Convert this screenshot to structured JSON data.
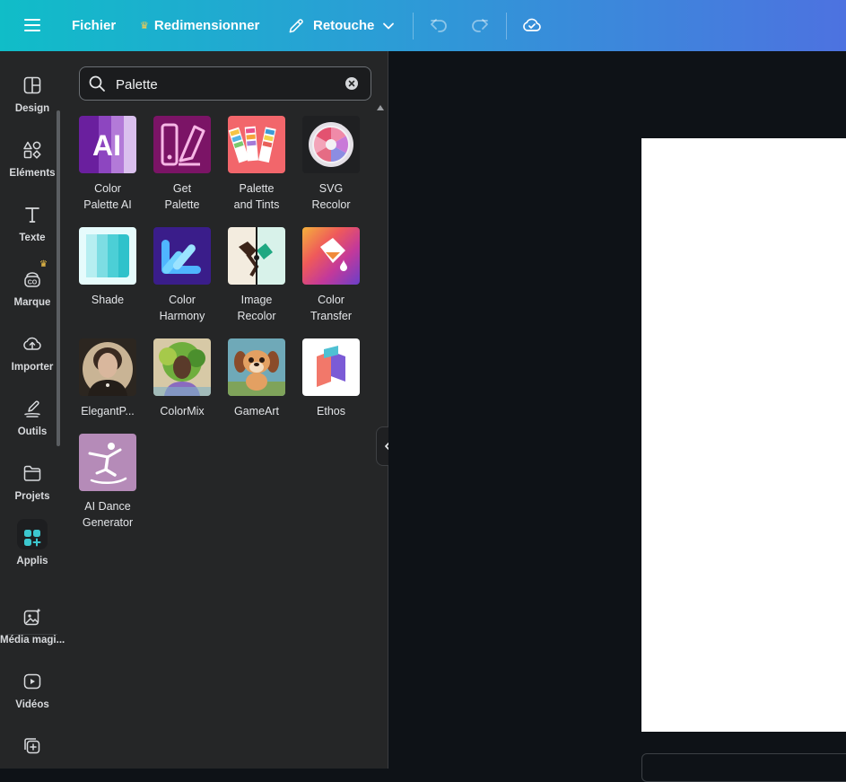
{
  "topbar": {
    "fichier": "Fichier",
    "resize": "Redimensionner",
    "retouche": "Retouche"
  },
  "rail": {
    "items": [
      {
        "label": "Design",
        "icon": "layout-icon"
      },
      {
        "label": "Éléments",
        "icon": "shapes-icon"
      },
      {
        "label": "Texte",
        "icon": "text-icon"
      },
      {
        "label": "Marque",
        "icon": "brand-icon"
      },
      {
        "label": "Importer",
        "icon": "cloud-upload-icon"
      },
      {
        "label": "Outils",
        "icon": "pen-icon"
      },
      {
        "label": "Projets",
        "icon": "folder-icon"
      },
      {
        "label": "Applis",
        "icon": "apps-icon"
      },
      {
        "label": "Média magi...",
        "icon": "magic-media-icon"
      },
      {
        "label": "Vidéos",
        "icon": "video-icon"
      }
    ]
  },
  "search": {
    "value": "Palette",
    "placeholder": "Palette"
  },
  "apps": [
    {
      "line1": "Color",
      "line2": "Palette AI"
    },
    {
      "line1": "Get",
      "line2": "Palette"
    },
    {
      "line1": "Palette",
      "line2": "and Tints"
    },
    {
      "line1": "SVG",
      "line2": "Recolor"
    },
    {
      "line1": "Shade",
      "line2": ""
    },
    {
      "line1": "Color",
      "line2": "Harmony"
    },
    {
      "line1": "Image",
      "line2": "Recolor"
    },
    {
      "line1": "Color",
      "line2": "Transfer"
    },
    {
      "line1": "ElegantP...",
      "line2": ""
    },
    {
      "line1": "ColorMix",
      "line2": ""
    },
    {
      "line1": "GameArt",
      "line2": ""
    },
    {
      "line1": "Ethos",
      "line2": ""
    },
    {
      "line1": "AI Dance",
      "line2": "Generator"
    }
  ],
  "colors": {
    "topbar_start": "#10bdc8",
    "topbar_end": "#4d72e0",
    "panel_bg": "#252627",
    "canvas_bg": "#0e1217",
    "crown": "#ffcd4a"
  }
}
